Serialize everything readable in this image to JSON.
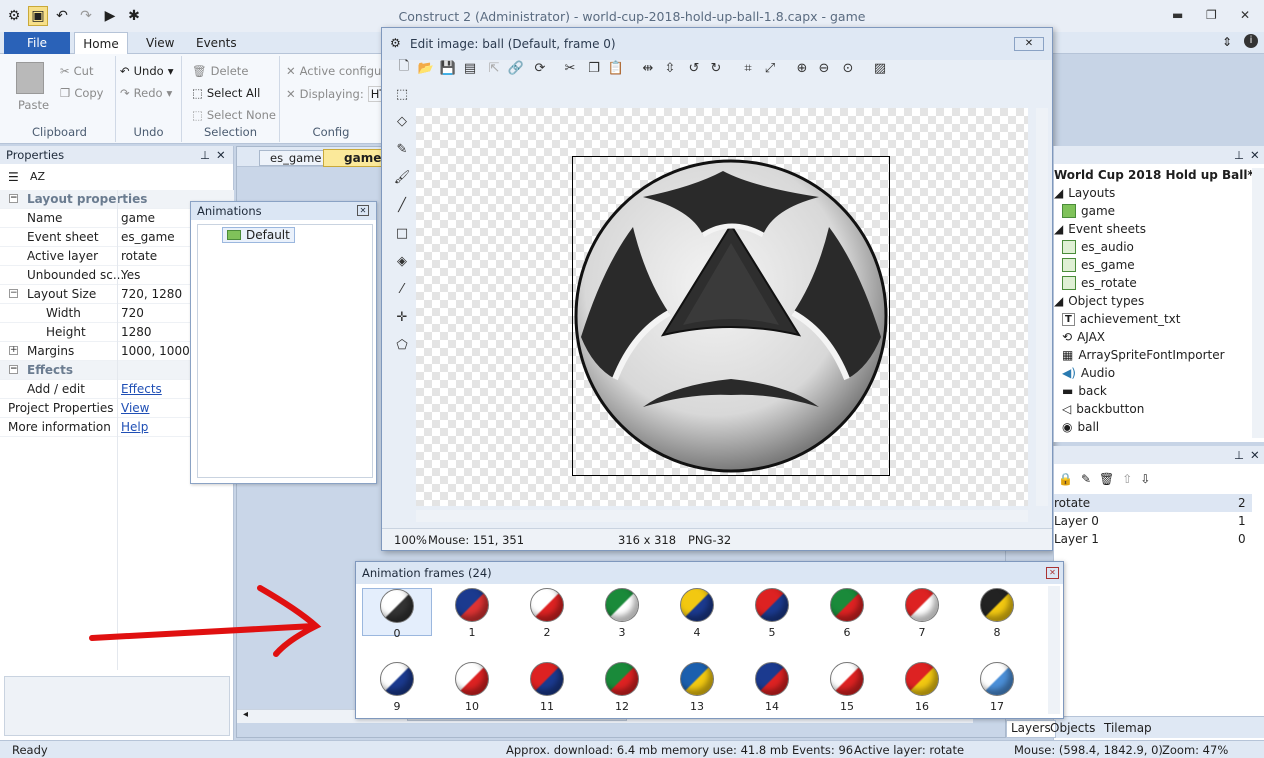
{
  "app": {
    "title": "Construct 2 (Administrator) - world-cup-2018-hold-up-ball-1.8.capx - game"
  },
  "ribbon": {
    "tabs": [
      "File",
      "Home",
      "View",
      "Events"
    ],
    "clipboard": {
      "paste": "Paste",
      "cut": "Cut",
      "copy": "Copy",
      "label": "Clipboard"
    },
    "undo": {
      "undo": "Undo",
      "redo": "Redo",
      "label": "Undo"
    },
    "selection": {
      "delete": "Delete",
      "select_all": "Select All",
      "select_none": "Select None",
      "label": "Selection"
    },
    "config": {
      "active": "Active configu",
      "displaying": "Displaying:",
      "displaying_value": "HT",
      "label": "Config"
    }
  },
  "properties": {
    "title": "Properties",
    "rows": [
      {
        "k": "Layout properties",
        "v": "",
        "cat": true
      },
      {
        "k": "Name",
        "v": "game"
      },
      {
        "k": "Event sheet",
        "v": "es_game"
      },
      {
        "k": "Active layer",
        "v": "rotate"
      },
      {
        "k": "Unbounded sc...",
        "v": "Yes"
      },
      {
        "k": "Layout Size",
        "v": "720, 1280",
        "expand": "minus"
      },
      {
        "k": "Width",
        "v": "720",
        "indent": true
      },
      {
        "k": "Height",
        "v": "1280",
        "indent": true
      },
      {
        "k": "Margins",
        "v": "1000, 1000",
        "expand": "plus"
      },
      {
        "k": "Effects",
        "v": "",
        "cat": true
      },
      {
        "k": "Add / edit",
        "v": "Effects",
        "link": true
      },
      {
        "k": "Project Properties",
        "v": "View",
        "link": true,
        "root": true
      },
      {
        "k": "More information",
        "v": "Help",
        "link": true,
        "root": true
      }
    ]
  },
  "layout_tabs": [
    "es_game",
    "game"
  ],
  "animations": {
    "title": "Animations",
    "items": [
      "Default"
    ]
  },
  "editor": {
    "title": "Edit image: ball (Default, frame 0)",
    "status": {
      "zoom": "100%",
      "mouse": "Mouse: 151, 351",
      "size": "316 x 318",
      "format": "PNG-32"
    }
  },
  "frames": {
    "title": "Animation frames (24)",
    "items": [
      {
        "n": "0",
        "c1": "#ffffff",
        "c2": "#333333"
      },
      {
        "n": "1",
        "c1": "#1b3a8f",
        "c2": "#d33"
      },
      {
        "n": "2",
        "c1": "#ffffff",
        "c2": "#d22"
      },
      {
        "n": "3",
        "c1": "#1a8a3a",
        "c2": "#ffffff"
      },
      {
        "n": "4",
        "c1": "#f2c811",
        "c2": "#1b3a8f"
      },
      {
        "n": "5",
        "c1": "#d22",
        "c2": "#1b3a8f"
      },
      {
        "n": "6",
        "c1": "#1a8a3a",
        "c2": "#d22"
      },
      {
        "n": "7",
        "c1": "#d22",
        "c2": "#ffffff"
      },
      {
        "n": "8",
        "c1": "#222",
        "c2": "#f2c811"
      },
      {
        "n": "9",
        "c1": "#ffffff",
        "c2": "#1b3a8f"
      },
      {
        "n": "10",
        "c1": "#ffffff",
        "c2": "#d22"
      },
      {
        "n": "11",
        "c1": "#d22",
        "c2": "#1b3a8f"
      },
      {
        "n": "12",
        "c1": "#1a8a3a",
        "c2": "#d22"
      },
      {
        "n": "13",
        "c1": "#1b5fae",
        "c2": "#f2c811"
      },
      {
        "n": "14",
        "c1": "#1b3a8f",
        "c2": "#d22"
      },
      {
        "n": "15",
        "c1": "#ffffff",
        "c2": "#d22"
      },
      {
        "n": "16",
        "c1": "#d22",
        "c2": "#f2c811"
      },
      {
        "n": "17",
        "c1": "#ffffff",
        "c2": "#4b8fd8"
      }
    ]
  },
  "project": {
    "title": "World Cup 2018 Hold up Ball*",
    "layouts_label": "Layouts",
    "layouts": [
      "game"
    ],
    "events_label": "Event sheets",
    "events": [
      "es_audio",
      "es_game",
      "es_rotate"
    ],
    "objects_label": "Object types",
    "objects": [
      "achievement_txt",
      "AJAX",
      "ArraySpriteFontImporter",
      "Audio",
      "back",
      "backbutton",
      "ball"
    ]
  },
  "layers": {
    "rows": [
      {
        "name": "rotate",
        "v": "2"
      },
      {
        "name": "Layer 0",
        "v": "1"
      },
      {
        "name": "Layer 1",
        "v": "0"
      }
    ],
    "tabs": [
      "Layers",
      "Objects",
      "Tilemap"
    ]
  },
  "status": {
    "ready": "Ready",
    "download": "Approx. download: 6.4 mb  memory use: 41.8 mb  Events: 96",
    "layer": "Active layer: rotate",
    "mouse": "Mouse: (598.4, 1842.9, 0)",
    "zoom": "Zoom: 47%"
  }
}
